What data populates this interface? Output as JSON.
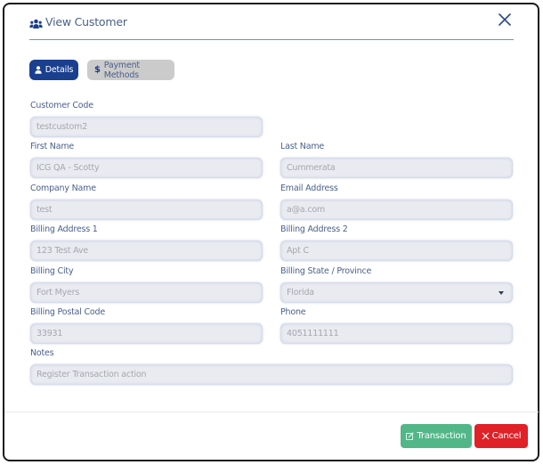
{
  "dialog": {
    "title": "View Customer",
    "title_icon": "users-icon",
    "close_icon": "close-icon"
  },
  "tabs": [
    {
      "label": "Details",
      "icon": "user-icon",
      "active": true
    },
    {
      "label": "Payment Methods",
      "icon": "dollar-icon",
      "active": false
    }
  ],
  "form": {
    "customer_code": {
      "label": "Customer Code",
      "value": "testcustom2"
    },
    "first_name": {
      "label": "First Name",
      "value": "ICG QA - Scotty"
    },
    "last_name": {
      "label": "Last Name",
      "value": "Cummerata"
    },
    "company_name": {
      "label": "Company Name",
      "value": "test"
    },
    "email_address": {
      "label": "Email Address",
      "value": "a@a.com"
    },
    "billing_address_1": {
      "label": "Billing Address 1",
      "value": "123 Test Ave"
    },
    "billing_address_2": {
      "label": "Billing Address 2",
      "value": "Apt C"
    },
    "billing_city": {
      "label": "Billing City",
      "value": "Fort Myers"
    },
    "billing_state": {
      "label": "Billing State / Province",
      "value": "Florida"
    },
    "billing_postal_code": {
      "label": "Billing Postal Code",
      "value": "33931"
    },
    "phone": {
      "label": "Phone",
      "value": "4051111111"
    },
    "notes": {
      "label": "Notes",
      "value": "Register Transaction action"
    }
  },
  "footer": {
    "transaction_label": "Transaction",
    "transaction_icon": "edit-icon",
    "cancel_label": "Cancel",
    "cancel_icon": "x-icon"
  },
  "colors": {
    "primary": "#1b3f8f",
    "label": "#4a5f8a",
    "success": "#52b788",
    "danger": "#e02127",
    "divider": "#5b9bd5"
  }
}
